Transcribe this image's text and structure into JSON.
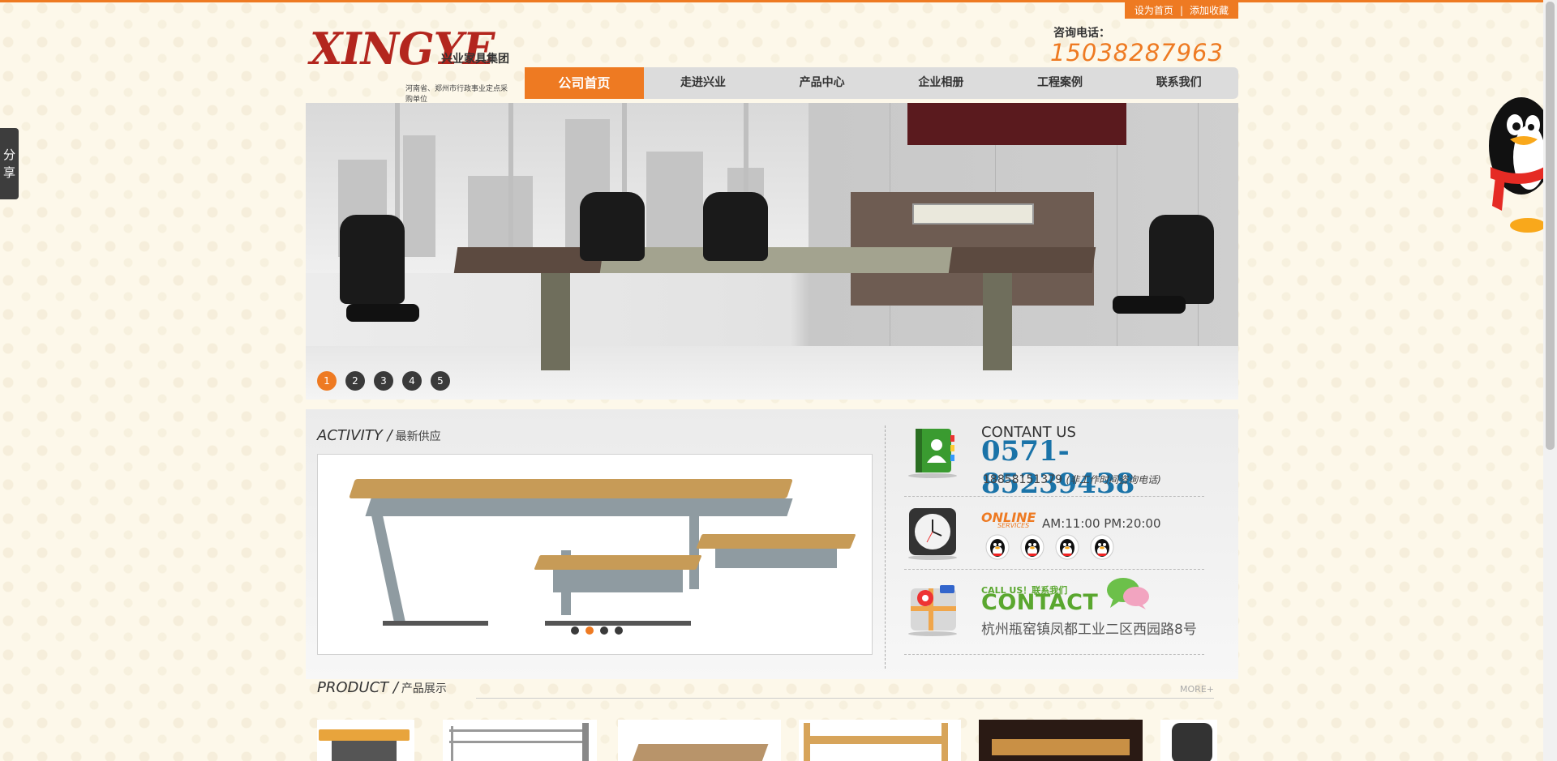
{
  "header": {
    "quick_links": [
      "设为首页",
      "|",
      "添加收藏"
    ],
    "logo_text": "XINGYE",
    "logo_cn": "兴业家具集团",
    "logo_sub": "河南省、郑州市行政事业定点采购单位",
    "hotline_label": "咨询电话：",
    "hotline_number": "15038287963"
  },
  "nav": {
    "items": [
      {
        "label": "公司首页",
        "active": true
      },
      {
        "label": "走进兴业",
        "active": false
      },
      {
        "label": "产品中心",
        "active": false
      },
      {
        "label": "企业相册",
        "active": false
      },
      {
        "label": "工程案例",
        "active": false
      },
      {
        "label": "联系我们",
        "active": false
      }
    ]
  },
  "banner": {
    "pager": [
      "1",
      "2",
      "3",
      "4",
      "5"
    ],
    "active_index": 0
  },
  "activity": {
    "title_en": "ACTIVITY /",
    "title_cn": "最新供应",
    "pager_count": 4,
    "active_index": 1
  },
  "contact": {
    "title": "CONTANT US",
    "phone": "0571-85239438",
    "mobile": "18858151379",
    "mobile_note": "(非工作时间咨询电话)",
    "online_label": "ONLINE",
    "online_sub": "SERVICES",
    "hours": "AM:11:00  PM:20:00",
    "qq_count": 4,
    "callus": "CALL US！联系我们",
    "contact_word": "CONTACT",
    "address": "杭州瓶窑镇凤都工业二区西园路8号"
  },
  "product": {
    "title_en": "PRODUCT /",
    "title_cn": "产品展示",
    "more": "MORE+"
  },
  "share": {
    "label1": "分",
    "label2": "享"
  },
  "colors": {
    "accent": "#ee7a22",
    "brand_red": "#b3261e",
    "phone_blue": "#1a73a8",
    "contact_green": "#5aa72f"
  }
}
